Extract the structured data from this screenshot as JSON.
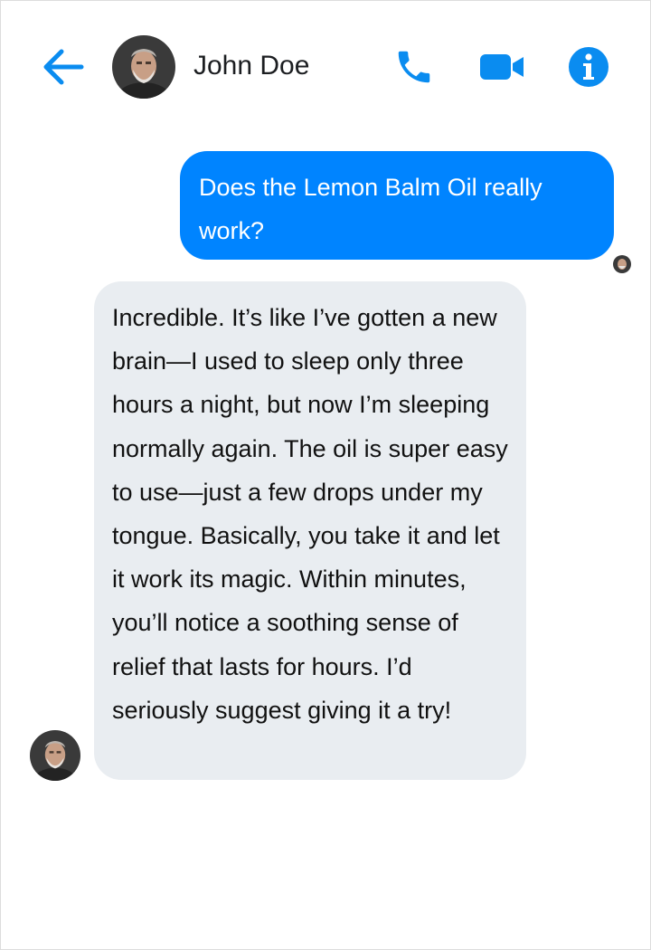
{
  "header": {
    "contact_name": "John Doe",
    "icons": {
      "back": "arrow-left-icon",
      "phone": "phone-icon",
      "video": "video-camera-icon",
      "info": "info-icon"
    },
    "accent_color": "#0084ff"
  },
  "messages": [
    {
      "direction": "outgoing",
      "text": "Does the Lemon Balm Oil really work?",
      "bubble_color": "#0084ff"
    },
    {
      "direction": "incoming",
      "text": "Incredible. It’s like I’ve gotten a new brain—I used to sleep only three hours a night, but now I’m sleeping normally again. The oil is super easy to use—just a few drops under my tongue. Basically, you take it and let it work its magic. Within minutes, you’ll notice a soothing sense of relief that lasts for hours. I’d seriously suggest giving it a try!",
      "bubble_color": "#e9edf1"
    }
  ]
}
